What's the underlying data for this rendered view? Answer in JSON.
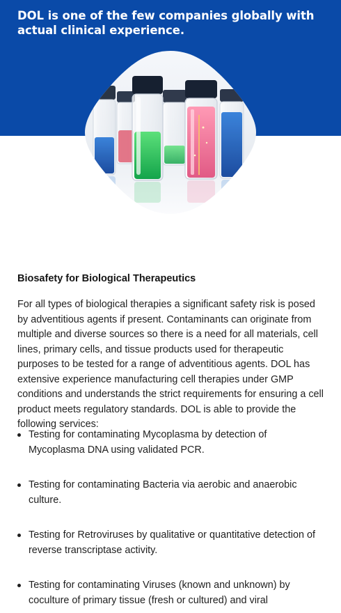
{
  "hero": {
    "title": "DOL is one of the few companies globally with actual clinical experience.",
    "colors": {
      "background": "#0a4aa8",
      "text": "#ffffff"
    }
  },
  "content": {
    "heading": "Biosafety for Biological Therapeutics",
    "intro": "For all types of biological therapies a significant safety risk is posed by adventitious agents if present. Contaminants can originate from multiple and diverse sources so there is a need for all materials, cell lines, primary cells, and tissue products used for therapeutic purposes to be tested for a range of adventitious agents. DOL has extensive experience manufacturing cell therapies under GMP conditions and understands the strict requirements for ensuring a cell product meets regulatory standards. DOL is able to provide the following services:",
    "services": [
      "Testing for contaminating Mycoplasma by detection of Mycoplasma DNA using validated PCR.",
      "Testing for contaminating Bacteria via aerobic and anaerobic culture.",
      "Testing for Retroviruses by qualitative or quantitative detection of reverse transcriptase activity.",
      "Testing for contaminating Viruses (known and unknown) by coculture of primary tissue (fresh or cultured) and viral"
    ]
  }
}
